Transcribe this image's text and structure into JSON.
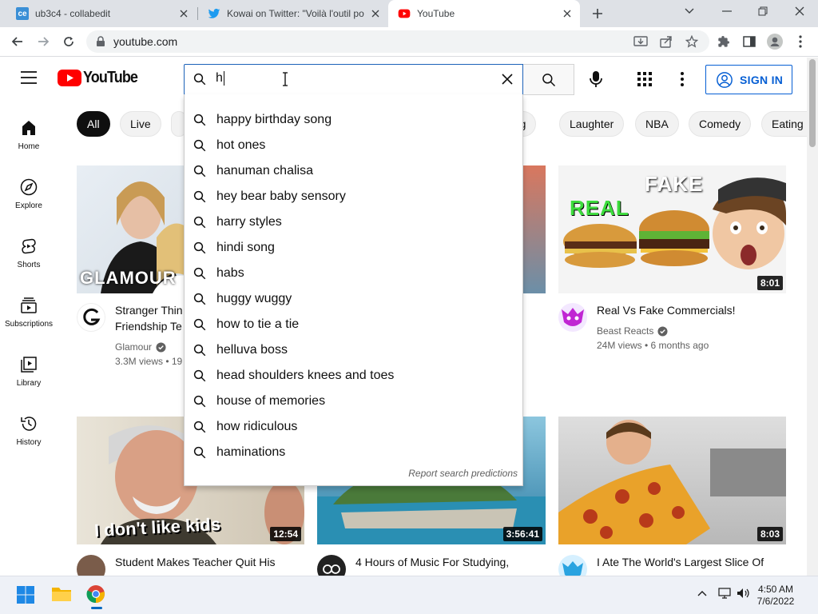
{
  "browser": {
    "tabs": [
      {
        "label": "ub3c4 - collabedit",
        "favicon": "collabedit-icon",
        "favicon_text": "ce",
        "active": false
      },
      {
        "label": "Kowai on Twitter: \"Voilà l'outil po",
        "favicon": "twitter-icon",
        "active": false
      },
      {
        "label": "YouTube",
        "favicon": "youtube-icon",
        "active": true
      }
    ],
    "url": "youtube.com"
  },
  "header": {
    "logo_text": "YouTube",
    "search_value": "h",
    "sign_in_label": "SIGN IN"
  },
  "sidebar": {
    "items": [
      {
        "label": "Home",
        "icon": "home-icon"
      },
      {
        "label": "Explore",
        "icon": "compass-icon"
      },
      {
        "label": "Shorts",
        "icon": "shorts-icon"
      },
      {
        "label": "Subscriptions",
        "icon": "subscriptions-icon"
      },
      {
        "label": "Library",
        "icon": "library-icon"
      },
      {
        "label": "History",
        "icon": "history-icon"
      }
    ]
  },
  "chips": [
    "All",
    "Live",
    "ning",
    "Laughter",
    "NBA",
    "Comedy",
    "Eating"
  ],
  "suggestions": [
    "happy birthday song",
    "hot ones",
    "hanuman chalisa",
    "hey bear baby sensory",
    "harry styles",
    "hindi song",
    "habs",
    "huggy wuggy",
    "how to tie a tie",
    "helluva boss",
    "head shoulders knees and toes",
    "house of memories",
    "how ridiculous",
    "haminations"
  ],
  "report_label": "Report search predictions",
  "videos": [
    {
      "title_line1": "Stranger Thin",
      "title_line2": "Friendship Te",
      "channel": "Glamour",
      "verified": true,
      "stats": "3.3M views • 19",
      "thumb_text": "GLAMOUR"
    },
    {
      "title_line1": "Real Vs Fake Commercials!",
      "title_line2": "",
      "channel": "Beast Reacts",
      "verified": true,
      "stats": "24M views • 6 months ago",
      "duration": "8:01",
      "thumb_text_a": "REAL",
      "thumb_text_b": "FAKE"
    },
    {
      "title_line1": "Student Makes Teacher Quit His",
      "duration": "12:54",
      "thumb_text": "I don't like kids"
    },
    {
      "title_line1": "4 Hours of Music For Studying,",
      "duration": "3:56:41"
    },
    {
      "title_line1": "I Ate The World's Largest Slice Of",
      "duration": "8:03"
    }
  ],
  "taskbar": {
    "time": "4:50 AM",
    "date": "7/6/2022"
  },
  "colors": {
    "youtube_red": "#ff0000",
    "link_blue": "#065fd4",
    "search_border": "#1c62b9"
  }
}
